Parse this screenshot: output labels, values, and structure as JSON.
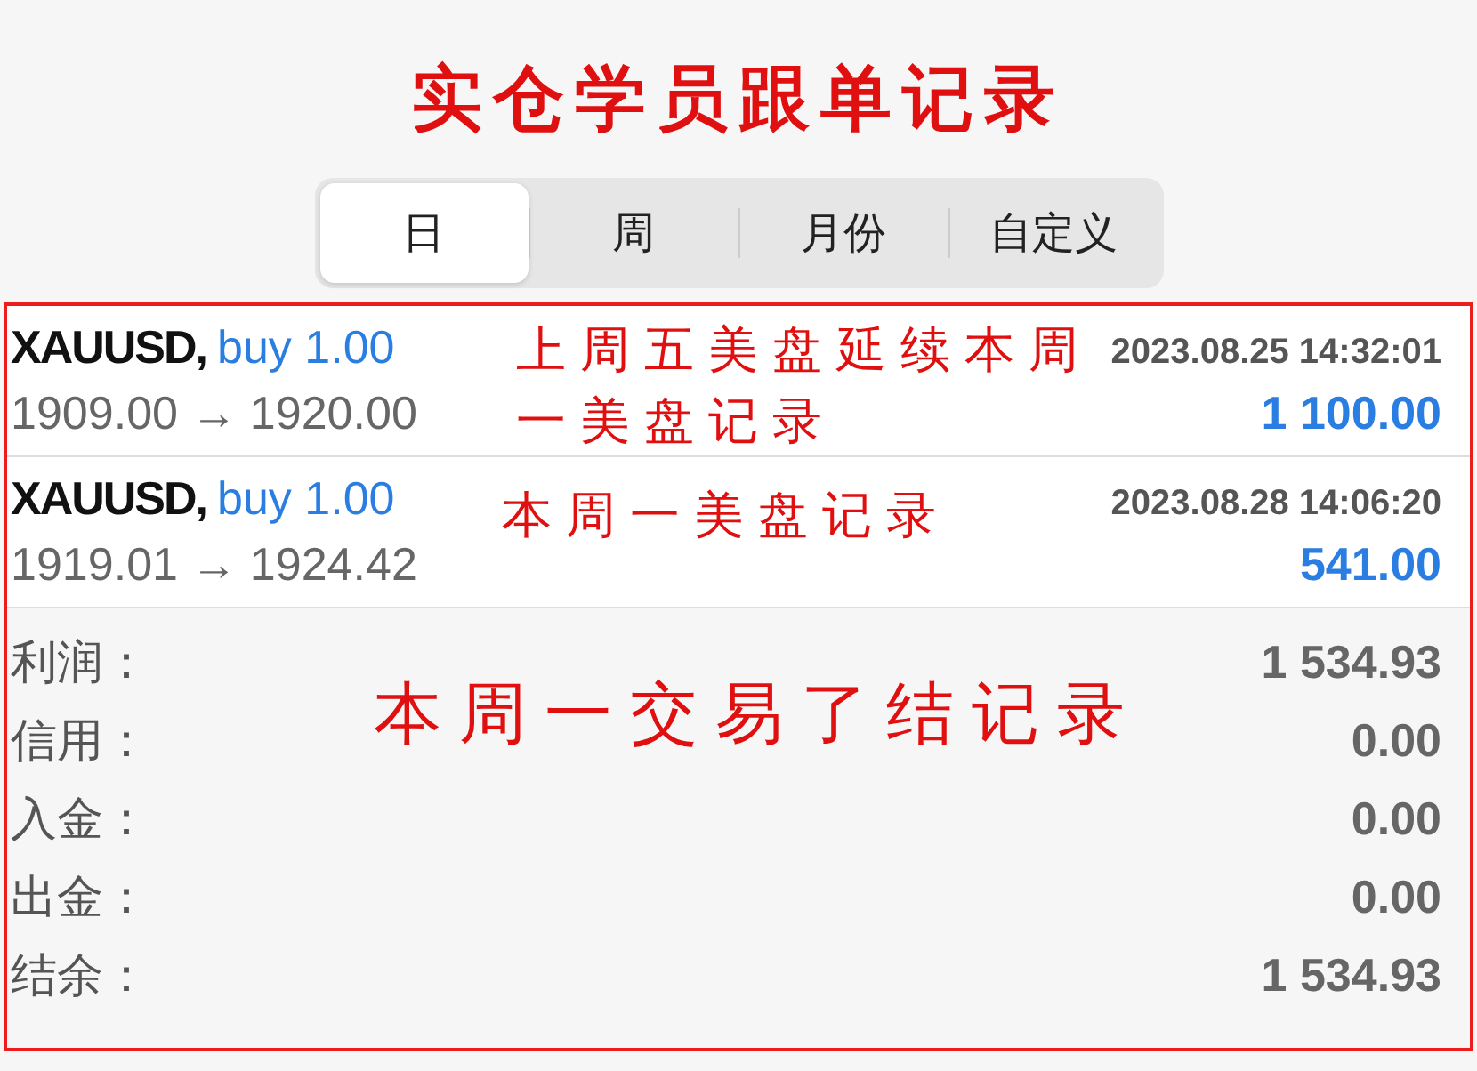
{
  "title": "实仓学员跟单记录",
  "tabs": [
    {
      "label": "日",
      "selected": true
    },
    {
      "label": "周",
      "selected": false
    },
    {
      "label": "月份",
      "selected": false
    },
    {
      "label": "自定义",
      "selected": false
    }
  ],
  "trades": [
    {
      "symbol": "XAUUSD,",
      "side": "buy 1.00",
      "time": "2023.08.25 14:32:01",
      "prices": "1909.00 → 1920.00",
      "profit": "1 100.00",
      "annotation": "上周五美盘延续本周一美盘记录"
    },
    {
      "symbol": "XAUUSD,",
      "side": "buy 1.00",
      "time": "2023.08.28 14:06:20",
      "prices": "1919.01 → 1924.42",
      "profit": "541.00",
      "annotation": "本周一美盘记录"
    }
  ],
  "summary": [
    {
      "label": "利润：",
      "value": "1 534.93"
    },
    {
      "label": "信用：",
      "value": "0.00"
    },
    {
      "label": "入金：",
      "value": "0.00"
    },
    {
      "label": "出金：",
      "value": "0.00"
    },
    {
      "label": "结余：",
      "value": "1 534.93"
    }
  ],
  "summary_annotation": "本周一交易了结记录"
}
